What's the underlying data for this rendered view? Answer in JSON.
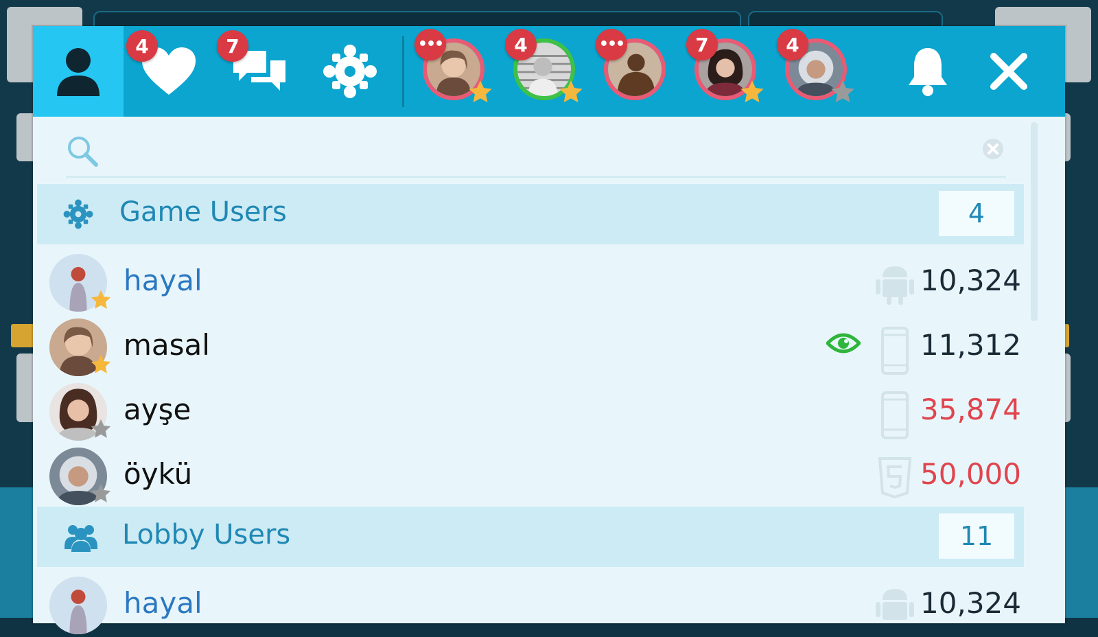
{
  "toolbar": {
    "tabs": [
      {
        "name": "profile",
        "badge": ""
      },
      {
        "name": "favorites",
        "badge": "4"
      },
      {
        "name": "messages",
        "badge": "7"
      },
      {
        "name": "settings",
        "badge": ""
      }
    ],
    "avatars": [
      {
        "badge": "•••",
        "ring": "#e95b74",
        "star": "#f5b83d"
      },
      {
        "badge": "4",
        "ring": "#3fc146",
        "star": "#f5b83d"
      },
      {
        "badge": "•••",
        "ring": "#e95b74",
        "star": ""
      },
      {
        "badge": "7",
        "ring": "#e95b74",
        "star": "#f5b83d"
      },
      {
        "badge": "4",
        "ring": "#e95b74",
        "star": "#9a9a9a"
      }
    ]
  },
  "search": {
    "placeholder": "",
    "value": ""
  },
  "sections": {
    "game": {
      "title": "Game Users",
      "count": "4"
    },
    "lobby": {
      "title": "Lobby Users",
      "count": "11"
    }
  },
  "game_users": [
    {
      "name": "hayal",
      "score": "10,324",
      "device": "android-icon",
      "star": "gold",
      "self": true
    },
    {
      "name": "masal",
      "score": "11,312",
      "device": "phone-icon",
      "star": "gold",
      "watching": true
    },
    {
      "name": "ayşe",
      "score": "35,874",
      "device": "phone-icon",
      "star": "gray",
      "red": true
    },
    {
      "name": "öykü",
      "score": "50,000",
      "device": "html5-icon",
      "star": "gray",
      "red": true
    }
  ],
  "lobby_users": [
    {
      "name": "hayal",
      "score": "10,324",
      "device": "android-icon"
    }
  ],
  "colors": {
    "accent": "#0ba5cf",
    "active_tab": "#25c6f2",
    "badge": "#d93a43",
    "section_text": "#2088b4",
    "red_score": "#e0454e"
  }
}
